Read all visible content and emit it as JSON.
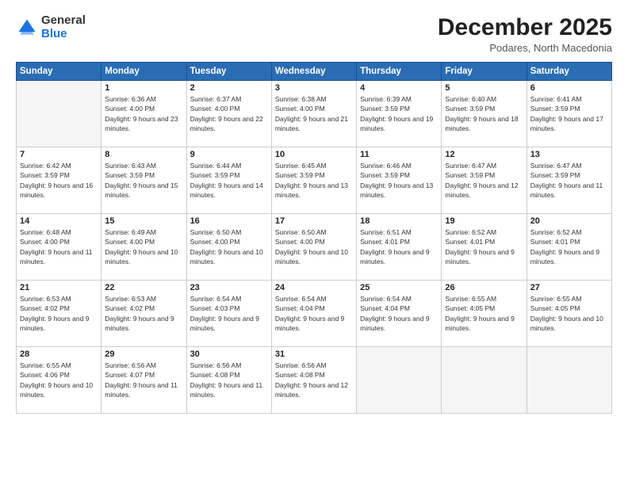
{
  "logo": {
    "general": "General",
    "blue": "Blue"
  },
  "header": {
    "month": "December 2025",
    "location": "Podares, North Macedonia"
  },
  "weekdays": [
    "Sunday",
    "Monday",
    "Tuesday",
    "Wednesday",
    "Thursday",
    "Friday",
    "Saturday"
  ],
  "weeks": [
    [
      {
        "day": "",
        "empty": true
      },
      {
        "day": "1",
        "sunrise": "6:36 AM",
        "sunset": "4:00 PM",
        "daylight": "9 hours and 23 minutes."
      },
      {
        "day": "2",
        "sunrise": "6:37 AM",
        "sunset": "4:00 PM",
        "daylight": "9 hours and 22 minutes."
      },
      {
        "day": "3",
        "sunrise": "6:38 AM",
        "sunset": "4:00 PM",
        "daylight": "9 hours and 21 minutes."
      },
      {
        "day": "4",
        "sunrise": "6:39 AM",
        "sunset": "3:59 PM",
        "daylight": "9 hours and 19 minutes."
      },
      {
        "day": "5",
        "sunrise": "6:40 AM",
        "sunset": "3:59 PM",
        "daylight": "9 hours and 18 minutes."
      },
      {
        "day": "6",
        "sunrise": "6:41 AM",
        "sunset": "3:59 PM",
        "daylight": "9 hours and 17 minutes."
      }
    ],
    [
      {
        "day": "7",
        "sunrise": "6:42 AM",
        "sunset": "3:59 PM",
        "daylight": "9 hours and 16 minutes."
      },
      {
        "day": "8",
        "sunrise": "6:43 AM",
        "sunset": "3:59 PM",
        "daylight": "9 hours and 15 minutes."
      },
      {
        "day": "9",
        "sunrise": "6:44 AM",
        "sunset": "3:59 PM",
        "daylight": "9 hours and 14 minutes."
      },
      {
        "day": "10",
        "sunrise": "6:45 AM",
        "sunset": "3:59 PM",
        "daylight": "9 hours and 13 minutes."
      },
      {
        "day": "11",
        "sunrise": "6:46 AM",
        "sunset": "3:59 PM",
        "daylight": "9 hours and 13 minutes."
      },
      {
        "day": "12",
        "sunrise": "6:47 AM",
        "sunset": "3:59 PM",
        "daylight": "9 hours and 12 minutes."
      },
      {
        "day": "13",
        "sunrise": "6:47 AM",
        "sunset": "3:59 PM",
        "daylight": "9 hours and 11 minutes."
      }
    ],
    [
      {
        "day": "14",
        "sunrise": "6:48 AM",
        "sunset": "4:00 PM",
        "daylight": "9 hours and 11 minutes."
      },
      {
        "day": "15",
        "sunrise": "6:49 AM",
        "sunset": "4:00 PM",
        "daylight": "9 hours and 10 minutes."
      },
      {
        "day": "16",
        "sunrise": "6:50 AM",
        "sunset": "4:00 PM",
        "daylight": "9 hours and 10 minutes."
      },
      {
        "day": "17",
        "sunrise": "6:50 AM",
        "sunset": "4:00 PM",
        "daylight": "9 hours and 10 minutes."
      },
      {
        "day": "18",
        "sunrise": "6:51 AM",
        "sunset": "4:01 PM",
        "daylight": "9 hours and 9 minutes."
      },
      {
        "day": "19",
        "sunrise": "6:52 AM",
        "sunset": "4:01 PM",
        "daylight": "9 hours and 9 minutes."
      },
      {
        "day": "20",
        "sunrise": "6:52 AM",
        "sunset": "4:01 PM",
        "daylight": "9 hours and 9 minutes."
      }
    ],
    [
      {
        "day": "21",
        "sunrise": "6:53 AM",
        "sunset": "4:02 PM",
        "daylight": "9 hours and 9 minutes."
      },
      {
        "day": "22",
        "sunrise": "6:53 AM",
        "sunset": "4:02 PM",
        "daylight": "9 hours and 9 minutes."
      },
      {
        "day": "23",
        "sunrise": "6:54 AM",
        "sunset": "4:03 PM",
        "daylight": "9 hours and 9 minutes."
      },
      {
        "day": "24",
        "sunrise": "6:54 AM",
        "sunset": "4:04 PM",
        "daylight": "9 hours and 9 minutes."
      },
      {
        "day": "25",
        "sunrise": "6:54 AM",
        "sunset": "4:04 PM",
        "daylight": "9 hours and 9 minutes."
      },
      {
        "day": "26",
        "sunrise": "6:55 AM",
        "sunset": "4:05 PM",
        "daylight": "9 hours and 9 minutes."
      },
      {
        "day": "27",
        "sunrise": "6:55 AM",
        "sunset": "4:05 PM",
        "daylight": "9 hours and 10 minutes."
      }
    ],
    [
      {
        "day": "28",
        "sunrise": "6:55 AM",
        "sunset": "4:06 PM",
        "daylight": "9 hours and 10 minutes."
      },
      {
        "day": "29",
        "sunrise": "6:56 AM",
        "sunset": "4:07 PM",
        "daylight": "9 hours and 11 minutes."
      },
      {
        "day": "30",
        "sunrise": "6:56 AM",
        "sunset": "4:08 PM",
        "daylight": "9 hours and 11 minutes."
      },
      {
        "day": "31",
        "sunrise": "6:56 AM",
        "sunset": "4:08 PM",
        "daylight": "9 hours and 12 minutes."
      },
      {
        "day": "",
        "empty": true
      },
      {
        "day": "",
        "empty": true
      },
      {
        "day": "",
        "empty": true
      }
    ]
  ]
}
